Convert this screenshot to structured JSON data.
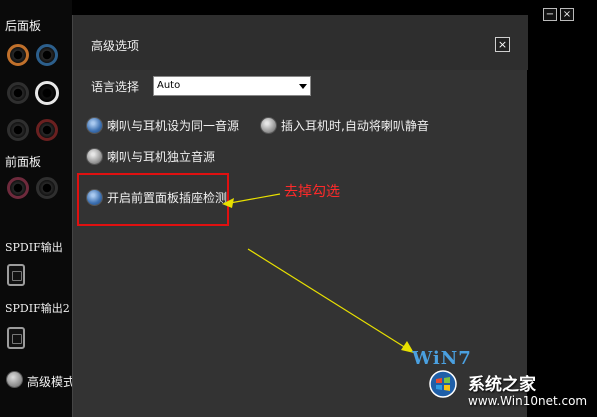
{
  "left_panel": {
    "rear_panel_label": "后面板",
    "front_panel_label": "前面板",
    "spdif_out_label": "SPDIF输出",
    "spdif_out2_label": "SPDIF输出2",
    "advanced_mode_label": "高级模式"
  },
  "window_buttons": {
    "minimize": "−",
    "close": "×"
  },
  "dialog": {
    "title": "高级选项",
    "close_glyph": "×",
    "language_label": "语言选择",
    "language_value": "Auto",
    "options": [
      {
        "label": "喇叭与耳机设为同一音源",
        "style": "blue"
      },
      {
        "label": "插入耳机时,自动将喇叭静音",
        "style": "gray"
      },
      {
        "label": "喇叭与耳机独立音源",
        "style": "gray"
      },
      {
        "label": "开启前置面板插座检测",
        "style": "blue"
      }
    ]
  },
  "annotation": {
    "text": "去掉勾选",
    "color": "#e01010"
  },
  "watermark": {
    "brand": "WiN7",
    "site_name": "系统之家",
    "url": "www.Win10net.com"
  },
  "colors": {
    "dialog_bg": "#333333",
    "panel_bg": "#0a0a0a",
    "arrow_yellow": "#e8e000"
  },
  "icons": [
    "jack-port-icon",
    "spdif-port-icon",
    "radio-icon",
    "close-icon",
    "minimize-icon",
    "windows-logo-icon",
    "arrow-icon"
  ]
}
